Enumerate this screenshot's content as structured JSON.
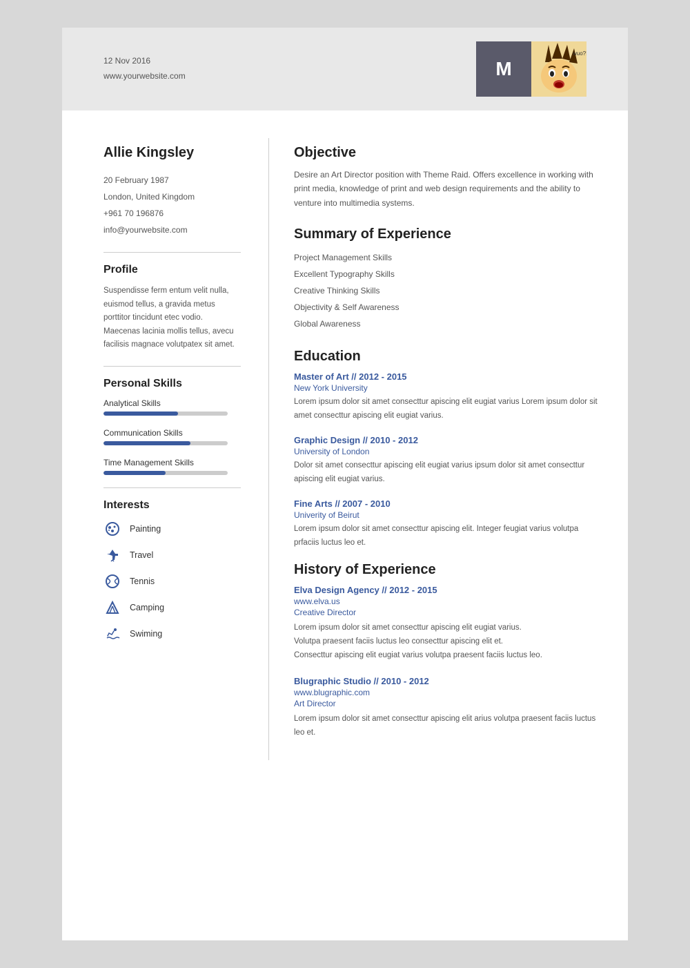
{
  "header": {
    "date": "12 Nov 2016",
    "website": "www.yourwebsite.com",
    "initial": "M",
    "avatar_emoji": "🤪"
  },
  "person": {
    "name": "Allie Kingsley",
    "dob": "20 February 1987",
    "location": "London, United Kingdom",
    "phone": "+961 70 196876",
    "email": "info@yourwebsite.com"
  },
  "profile": {
    "title": "Profile",
    "text": "Suspendisse ferm entum velit nulla, euismod tellus, a gravida metus porttitor tincidunt etec vodio. Maecenas lacinia mollis tellus, avecu facilisis magnace volutpatex sit amet."
  },
  "personal_skills": {
    "title": "Personal Skills",
    "skills": [
      {
        "name": "Analytical Skills",
        "percent": 60
      },
      {
        "name": "Communication Skills",
        "percent": 70
      },
      {
        "name": "Time Management Skills",
        "percent": 50
      }
    ]
  },
  "interests": {
    "title": "Interests",
    "items": [
      {
        "icon": "🎨",
        "label": "Painting",
        "icon_name": "painting-icon"
      },
      {
        "icon": "✈️",
        "label": "Travel",
        "icon_name": "travel-icon"
      },
      {
        "icon": "🎾",
        "label": "Tennis",
        "icon_name": "tennis-icon"
      },
      {
        "icon": "⛺",
        "label": "Camping",
        "icon_name": "camping-icon"
      },
      {
        "icon": "🏊",
        "label": "Swiming",
        "icon_name": "swimming-icon"
      }
    ]
  },
  "objective": {
    "title": "Objective",
    "text": "Desire an Art Director position with Theme Raid. Offers excellence in working with print media, knowledge of print and web design requirements and the ability to venture into multimedia systems."
  },
  "summary": {
    "title": "Summary of Experience",
    "items": [
      "Project Management Skills",
      "Excellent Typography Skills",
      "Creative Thinking Skills",
      "Objectivity & Self Awareness",
      "Global Awareness"
    ]
  },
  "education": {
    "title": "Education",
    "entries": [
      {
        "degree": "Master of Art // 2012 - 2015",
        "school": "New York University",
        "desc": "Lorem ipsum dolor sit amet consecttur apiscing elit eugiat varius Lorem ipsum dolor sit amet consecttur apiscing elit eugiat varius."
      },
      {
        "degree": "Graphic Design // 2010 - 2012",
        "school": "University of London",
        "desc": "Dolor sit amet consecttur apiscing elit eugiat varius  ipsum dolor sit amet consecttur apiscing elit eugiat varius."
      },
      {
        "degree": "Fine Arts // 2007 - 2010",
        "school": "Univerity of Beirut",
        "desc": "Lorem ipsum dolor sit amet consecttur apiscing elit. Integer feugiat varius volutpa prfaciis luctus leo et."
      }
    ]
  },
  "history": {
    "title": "History of Experience",
    "entries": [
      {
        "company": "Elva Design Agency // 2012 - 2015",
        "url": "www.elva.us",
        "role": "Creative Director",
        "desc": "Lorem ipsum dolor sit amet consecttur apiscing elit eugiat varius.\nVolutpa praesent faciis luctus leo consecttur apiscing elit et.\nConsecttur apiscing elit eugiat varius volutpa praesent faciis luctus leo."
      },
      {
        "company": "Blugraphic Studio // 2010 - 2012",
        "url": "www.blugraphic.com",
        "role": "Art Director",
        "desc": "Lorem ipsum dolor sit amet consecttur apiscing elit arius volutpa praesent faciis luctus leo et."
      }
    ]
  }
}
